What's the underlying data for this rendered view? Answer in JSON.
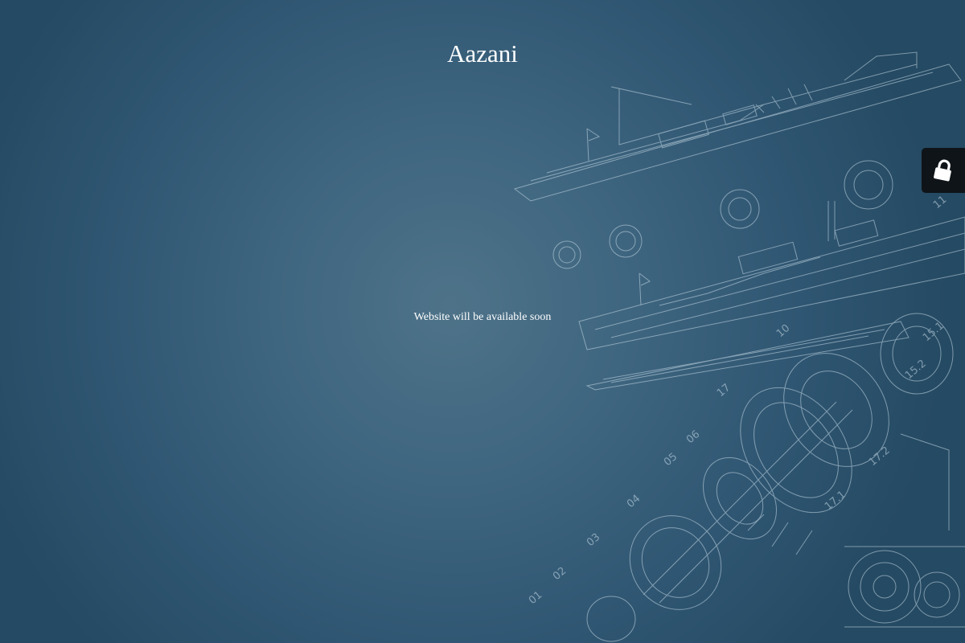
{
  "site": {
    "title": "Aazani",
    "message": "Website will be available soon"
  },
  "login_tab": {
    "icon": "lock-icon"
  },
  "colors": {
    "background_center": "#4e7389",
    "background_edge": "#254a63",
    "text": "#ffffff",
    "login_tab_bg": "#0e1418"
  }
}
